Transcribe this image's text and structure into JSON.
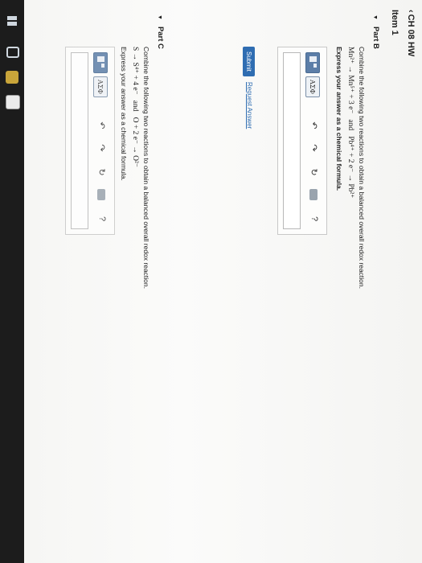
{
  "nav": {
    "back_label": "CH 08 HW"
  },
  "item": {
    "title": "Item 1"
  },
  "partB": {
    "header": "Part B",
    "instruction": "Combine the following two reactions to obtain a balanced overall redox reaction.",
    "reaction1": "Mn²⁺ → Mn⁵⁺ + 3 e⁻",
    "connector": "and",
    "reaction2": "Pb⁴⁺ + 2 e⁻ → Pb²⁺",
    "answer_prompt": "Express your answer as a chemical formula.",
    "answer_value": "",
    "submit_label": "Submit",
    "request_label": "Request Answer"
  },
  "partC": {
    "header": "Part C",
    "instruction": "Combine the following two reactions to obtain a balanced overall redox reaction.",
    "reaction1": "S → S⁴⁺ + 4 e⁻",
    "connector": "and",
    "reaction2": "O + 2 e⁻ → O²⁻",
    "answer_prompt": "Express your answer as a chemical formula.",
    "answer_value": ""
  },
  "toolbar": {
    "greek_label": "AΣΦ",
    "undo_icon": "undo-icon",
    "redo_icon": "redo-icon",
    "reset_icon": "reset-icon",
    "keyboard_icon": "keyboard-icon",
    "help_label": "?"
  },
  "colors": {
    "accent": "#2f6db2",
    "background": "#f6f6f4"
  }
}
